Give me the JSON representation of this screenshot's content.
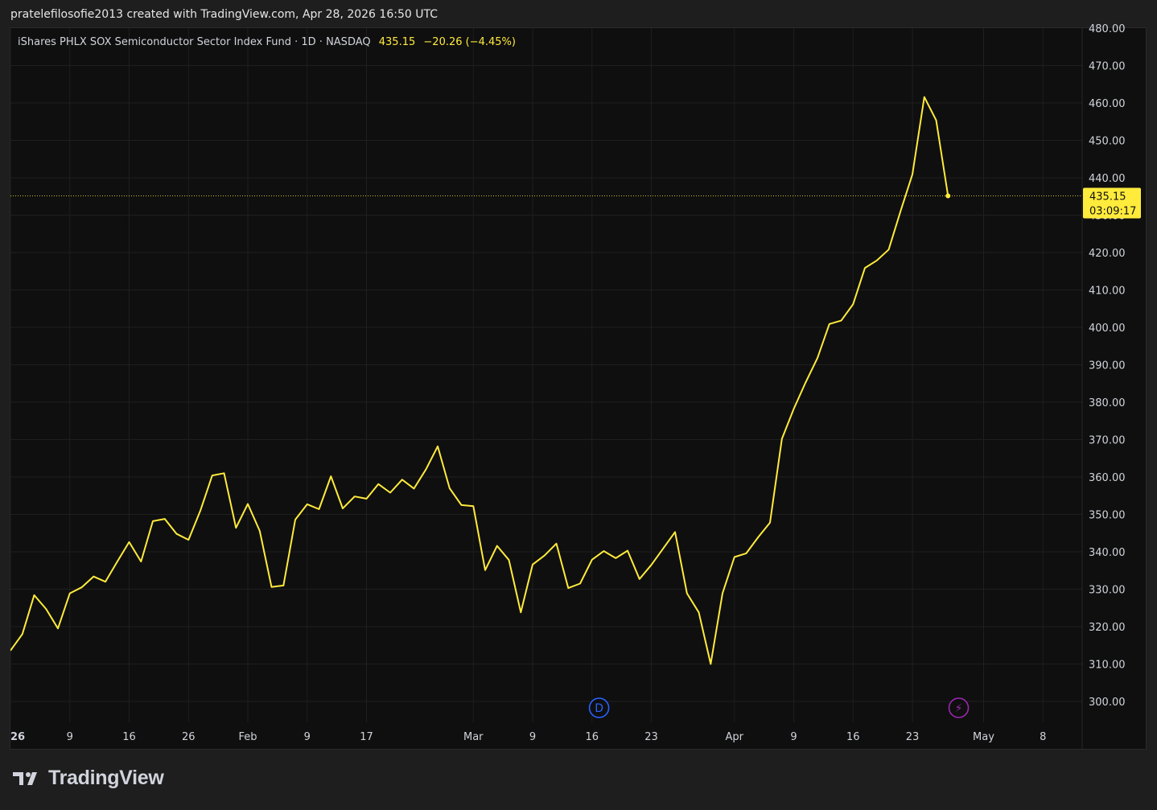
{
  "header": {
    "credit": "pratelefilosofie2013 created with TradingView.com, Apr 28, 2026 16:50 UTC"
  },
  "legend": {
    "symbol": "iShares PHLX SOX Semiconductor Sector Index Fund · 1D · NASDAQ",
    "price": "435.15",
    "change": "−20.26 (−4.45%)"
  },
  "price_label": {
    "price": "435.15",
    "countdown": "03:09:17"
  },
  "brand": {
    "name": "TradingView"
  },
  "colors": {
    "line": "#ffeb3b",
    "background": "#0f0f0f",
    "grid": "#1f1f1f",
    "axis_text": "#d1d4dc",
    "dividend_marker": "#2962ff",
    "earnings_marker": "#9c27b0"
  },
  "markers": [
    {
      "icon": "dividend-icon",
      "letter": "D",
      "date": "Mar 17"
    },
    {
      "icon": "earnings-flash-icon",
      "letter": "⚡",
      "date": "Apr 27"
    }
  ],
  "chart_data": {
    "type": "line",
    "title": "iShares PHLX SOX Semiconductor Sector Index Fund · 1D · NASDAQ",
    "ylim": [
      300,
      480
    ],
    "y_ticks": [
      "300.00",
      "310.00",
      "320.00",
      "330.00",
      "340.00",
      "350.00",
      "360.00",
      "370.00",
      "380.00",
      "390.00",
      "400.00",
      "410.00",
      "420.00",
      "430.00",
      "440.00",
      "450.00",
      "460.00",
      "470.00",
      "480.00"
    ],
    "x_ticks": [
      {
        "label": "26",
        "pos": 0,
        "bold": true
      },
      {
        "label": "9",
        "pos": 5
      },
      {
        "label": "16",
        "pos": 10
      },
      {
        "label": "26",
        "pos": 15
      },
      {
        "label": "Feb",
        "pos": 20
      },
      {
        "label": "9",
        "pos": 25
      },
      {
        "label": "17",
        "pos": 30
      },
      {
        "label": "Mar",
        "pos": 39
      },
      {
        "label": "9",
        "pos": 44
      },
      {
        "label": "16",
        "pos": 49
      },
      {
        "label": "23",
        "pos": 54
      },
      {
        "label": "Apr",
        "pos": 61
      },
      {
        "label": "9",
        "pos": 66
      },
      {
        "label": "16",
        "pos": 71
      },
      {
        "label": "23",
        "pos": 76
      },
      {
        "label": "May",
        "pos": 82
      },
      {
        "label": "8",
        "pos": 87
      }
    ],
    "x_max": 95,
    "grid": true,
    "last_price_line": 435.15,
    "series": [
      {
        "values": [
          313.6,
          318.0,
          328.4,
          324.7,
          319.5,
          328.9,
          330.5,
          333.4,
          332.0,
          337.4,
          342.6,
          337.4,
          348.2,
          348.8,
          344.8,
          343.2,
          351.0,
          360.4,
          361.0,
          346.4,
          352.8,
          345.6,
          330.6,
          331.0,
          348.6,
          352.7,
          351.4,
          360.2,
          351.6,
          354.8,
          354.2,
          358.1,
          355.8,
          359.3,
          356.9,
          362.0,
          368.2,
          357.0,
          352.5,
          352.2,
          335.1,
          341.6,
          337.8,
          323.8,
          336.6,
          339.0,
          342.2,
          330.3,
          331.5,
          337.9,
          340.2,
          338.3,
          340.3,
          332.7,
          336.5,
          340.9,
          345.3,
          328.9,
          323.8,
          310.0,
          328.9,
          338.6,
          339.6,
          343.9,
          347.8,
          370.2,
          378.2,
          385.3,
          391.8,
          400.9,
          401.8,
          406.2,
          415.9,
          417.9,
          420.8,
          431.1,
          440.9,
          461.6,
          455.4,
          435.15
        ]
      }
    ]
  }
}
